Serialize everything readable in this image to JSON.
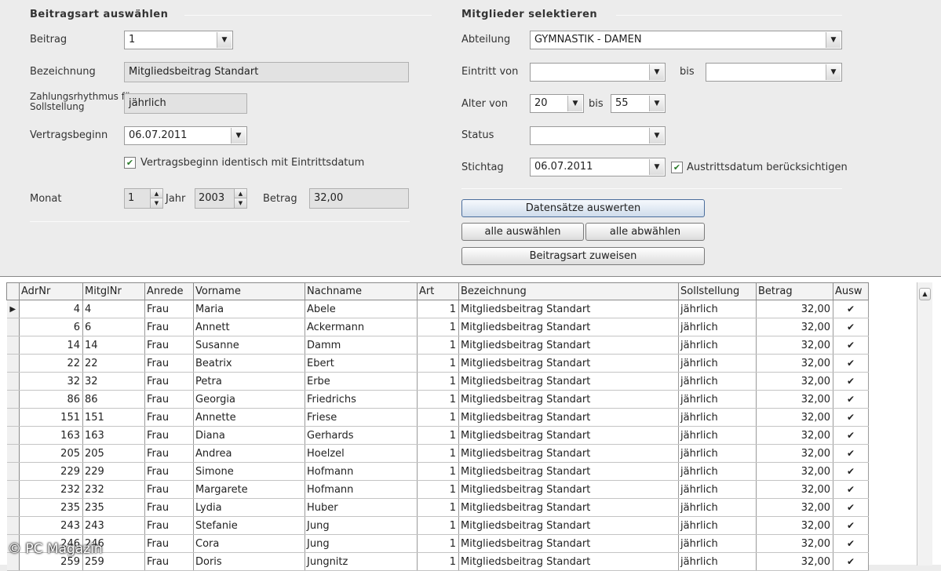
{
  "left_section": {
    "title": "Beitragsart auswählen",
    "beitrag": {
      "label": "Beitrag",
      "value": "1"
    },
    "bezeichnung": {
      "label": "Bezeichnung",
      "value": "Mitgliedsbeitrag Standart"
    },
    "zahlungsart": {
      "label_line1": "Zahlungsrhythmus für",
      "label_line2": "Sollstellung",
      "value": "jährlich"
    },
    "vertragsbeginn": {
      "label": "Vertragsbeginn",
      "value": "06.07.2011"
    },
    "identisch_checkbox": {
      "label": "Vertragsbeginn identisch mit Eintrittsdatum",
      "checked": true
    },
    "monat": {
      "label": "Monat",
      "value": "1"
    },
    "jahr": {
      "label": "Jahr",
      "value": "2003"
    },
    "betrag": {
      "label": "Betrag",
      "value": "32,00"
    }
  },
  "right_section": {
    "title": "Mitglieder selektieren",
    "abteilung": {
      "label": "Abteilung",
      "value": "GYMNASTIK - DAMEN"
    },
    "eintritt": {
      "label": "Eintritt von",
      "bis_label": "bis",
      "von_value": "",
      "bis_value": ""
    },
    "alter": {
      "label": "Alter von",
      "von_value": "20",
      "bis_label": "bis",
      "bis_value": "55"
    },
    "status": {
      "label": "Status",
      "value": ""
    },
    "stichtag": {
      "label": "Stichtag",
      "value": "06.07.2011"
    },
    "austritt_checkbox": {
      "label": "Austrittsdatum berücksichtigen",
      "checked": true
    }
  },
  "buttons": {
    "auswerten": "Datensätze auswerten",
    "alle_auswaehlen": "alle auswählen",
    "alle_abwaehlen": "alle abwählen",
    "zuweisen": "Beitragsart zuweisen"
  },
  "grid": {
    "columns": [
      "AdrNr",
      "MitglNr",
      "Anrede",
      "Vorname",
      "Nachname",
      "Art",
      "Bezeichnung",
      "Sollstellung",
      "Betrag",
      "Ausw"
    ],
    "rows": [
      {
        "adrnr": "4",
        "mitglnr": "4",
        "anrede": "Frau",
        "vorname": "Maria",
        "nachname": "Abele",
        "art": "1",
        "bezeichnung": "Mitgliedsbeitrag Standart",
        "soll": "jährlich",
        "betrag": "32,00",
        "ausw": "✔"
      },
      {
        "adrnr": "6",
        "mitglnr": "6",
        "anrede": "Frau",
        "vorname": "Annett",
        "nachname": "Ackermann",
        "art": "1",
        "bezeichnung": "Mitgliedsbeitrag Standart",
        "soll": "jährlich",
        "betrag": "32,00",
        "ausw": "✔"
      },
      {
        "adrnr": "14",
        "mitglnr": "14",
        "anrede": "Frau",
        "vorname": "Susanne",
        "nachname": "Damm",
        "art": "1",
        "bezeichnung": "Mitgliedsbeitrag Standart",
        "soll": "jährlich",
        "betrag": "32,00",
        "ausw": "✔"
      },
      {
        "adrnr": "22",
        "mitglnr": "22",
        "anrede": "Frau",
        "vorname": "Beatrix",
        "nachname": "Ebert",
        "art": "1",
        "bezeichnung": "Mitgliedsbeitrag Standart",
        "soll": "jährlich",
        "betrag": "32,00",
        "ausw": "✔"
      },
      {
        "adrnr": "32",
        "mitglnr": "32",
        "anrede": "Frau",
        "vorname": "Petra",
        "nachname": "Erbe",
        "art": "1",
        "bezeichnung": "Mitgliedsbeitrag Standart",
        "soll": "jährlich",
        "betrag": "32,00",
        "ausw": "✔"
      },
      {
        "adrnr": "86",
        "mitglnr": "86",
        "anrede": "Frau",
        "vorname": "Georgia",
        "nachname": "Friedrichs",
        "art": "1",
        "bezeichnung": "Mitgliedsbeitrag Standart",
        "soll": "jährlich",
        "betrag": "32,00",
        "ausw": "✔"
      },
      {
        "adrnr": "151",
        "mitglnr": "151",
        "anrede": "Frau",
        "vorname": "Annette",
        "nachname": "Friese",
        "art": "1",
        "bezeichnung": "Mitgliedsbeitrag Standart",
        "soll": "jährlich",
        "betrag": "32,00",
        "ausw": "✔"
      },
      {
        "adrnr": "163",
        "mitglnr": "163",
        "anrede": "Frau",
        "vorname": "Diana",
        "nachname": "Gerhards",
        "art": "1",
        "bezeichnung": "Mitgliedsbeitrag Standart",
        "soll": "jährlich",
        "betrag": "32,00",
        "ausw": "✔"
      },
      {
        "adrnr": "205",
        "mitglnr": "205",
        "anrede": "Frau",
        "vorname": "Andrea",
        "nachname": "Hoelzel",
        "art": "1",
        "bezeichnung": "Mitgliedsbeitrag Standart",
        "soll": "jährlich",
        "betrag": "32,00",
        "ausw": "✔"
      },
      {
        "adrnr": "229",
        "mitglnr": "229",
        "anrede": "Frau",
        "vorname": "Simone",
        "nachname": "Hofmann",
        "art": "1",
        "bezeichnung": "Mitgliedsbeitrag Standart",
        "soll": "jährlich",
        "betrag": "32,00",
        "ausw": "✔"
      },
      {
        "adrnr": "232",
        "mitglnr": "232",
        "anrede": "Frau",
        "vorname": "Margarete",
        "nachname": "Hofmann",
        "art": "1",
        "bezeichnung": "Mitgliedsbeitrag Standart",
        "soll": "jährlich",
        "betrag": "32,00",
        "ausw": "✔"
      },
      {
        "adrnr": "235",
        "mitglnr": "235",
        "anrede": "Frau",
        "vorname": "Lydia",
        "nachname": "Huber",
        "art": "1",
        "bezeichnung": "Mitgliedsbeitrag Standart",
        "soll": "jährlich",
        "betrag": "32,00",
        "ausw": "✔"
      },
      {
        "adrnr": "243",
        "mitglnr": "243",
        "anrede": "Frau",
        "vorname": "Stefanie",
        "nachname": "Jung",
        "art": "1",
        "bezeichnung": "Mitgliedsbeitrag Standart",
        "soll": "jährlich",
        "betrag": "32,00",
        "ausw": "✔"
      },
      {
        "adrnr": "246",
        "mitglnr": "246",
        "anrede": "Frau",
        "vorname": "Cora",
        "nachname": "Jung",
        "art": "1",
        "bezeichnung": "Mitgliedsbeitrag Standart",
        "soll": "jährlich",
        "betrag": "32,00",
        "ausw": "✔"
      },
      {
        "adrnr": "259",
        "mitglnr": "259",
        "anrede": "Frau",
        "vorname": "Doris",
        "nachname": "Jungnitz",
        "art": "1",
        "bezeichnung": "Mitgliedsbeitrag Standart",
        "soll": "jährlich",
        "betrag": "32,00",
        "ausw": "✔"
      }
    ]
  },
  "watermark": "© PC Magazin"
}
